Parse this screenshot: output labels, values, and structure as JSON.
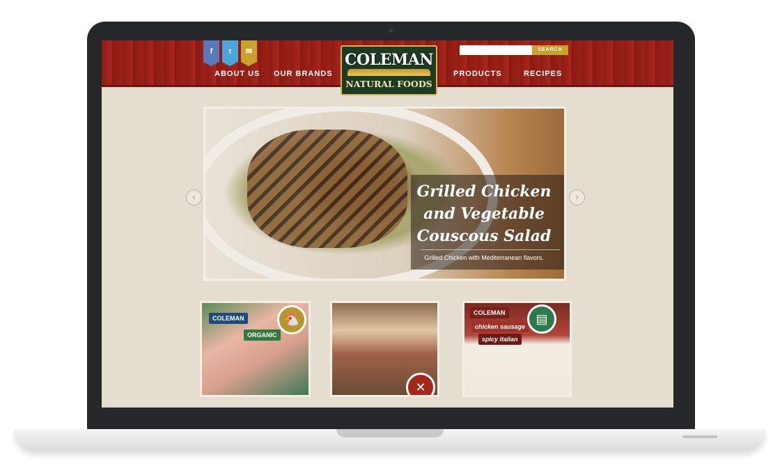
{
  "header": {
    "social": {
      "facebook": "f",
      "twitter": "t",
      "email": "✉"
    },
    "nav": {
      "about": "ABOUT US",
      "brands": "OUR BRANDS",
      "products": "PRODUCTS",
      "recipes": "RECIPES"
    },
    "logo": {
      "top": "COLEMAN",
      "bottom": "NATURAL FOODS"
    },
    "search": {
      "button": "SEARCH",
      "placeholder": ""
    }
  },
  "hero": {
    "title": "Grilled Chicken and Vegetable Couscous Salad",
    "subtitle": "Grilled Chicken with Mediterranean flavors.",
    "prev": "‹",
    "next": "›"
  },
  "tiles": [
    {
      "label1": "COLEMAN",
      "label2": "ORGANIC",
      "icon": "chicken-icon"
    },
    {
      "icon": "fork-knife-icon"
    },
    {
      "label1": "COLEMAN",
      "label2": "chicken sausage",
      "label3": "spicy italian",
      "icon": "newspaper-icon"
    }
  ],
  "colors": {
    "header_red": "#9b2219",
    "accent_gold": "#c9a22c",
    "background": "#e3ded0"
  }
}
